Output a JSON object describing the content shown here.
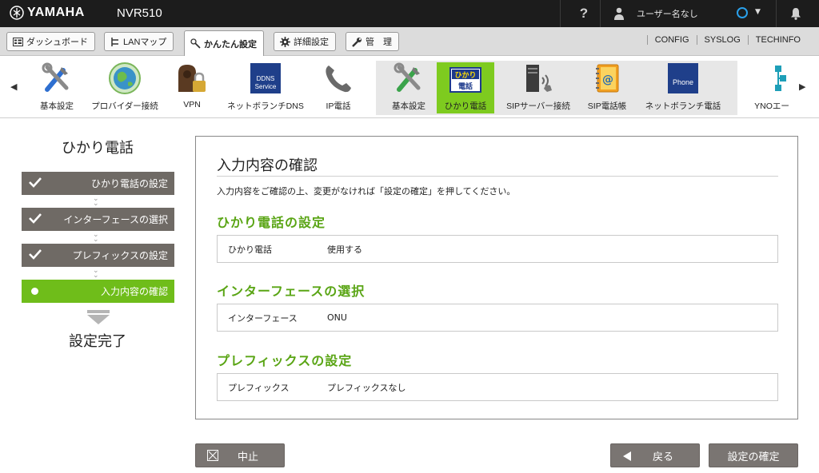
{
  "header": {
    "logo_text": "YAMAHA",
    "model": "NVR510",
    "help_label": "?",
    "user_name": "ユーザー名なし"
  },
  "tabs": [
    {
      "label": "ダッシュボード",
      "icon": "dashboard-icon"
    },
    {
      "label": "LANマップ",
      "icon": "lan-map-icon"
    },
    {
      "label": "かんたん設定",
      "icon": "wand-icon",
      "active": true
    },
    {
      "label": "詳細設定",
      "icon": "gear-icon"
    },
    {
      "label": "管　理",
      "icon": "wrench-icon"
    }
  ],
  "top_links": [
    "CONFIG",
    "SYSLOG",
    "TECHINFO"
  ],
  "icon_strip": {
    "items": [
      {
        "label": "基本設定",
        "icon": "tools-icon"
      },
      {
        "label": "プロバイダー接続",
        "icon": "globe-icon"
      },
      {
        "label": "VPN",
        "icon": "vpn-lock-icon"
      },
      {
        "label": "ネットボランチDNS",
        "icon": "ddns-service-icon",
        "icon_text": [
          "DDNS",
          "Service"
        ]
      },
      {
        "label": "IP電話",
        "icon": "phone-icon"
      },
      {
        "label": "基本設定",
        "icon": "tools-icon"
      },
      {
        "label": "ひかり電話",
        "icon": "hikari-phone-icon",
        "icon_text": [
          "ひかり",
          "電話"
        ],
        "selected": true
      },
      {
        "label": "SIPサーバー接続",
        "icon": "sip-server-icon"
      },
      {
        "label": "SIP電話帳",
        "icon": "phonebook-icon"
      },
      {
        "label": "ネットボランチ電話",
        "icon": "netvolante-phone-icon",
        "icon_text": [
          "Phone"
        ]
      },
      {
        "label": "YNOエー",
        "icon": "yno-network-icon"
      }
    ]
  },
  "wizard": {
    "title": "ひかり電話",
    "steps": [
      {
        "label": "ひかり電話の設定",
        "state": "done"
      },
      {
        "label": "インターフェースの選択",
        "state": "done"
      },
      {
        "label": "プレフィックスの設定",
        "state": "done"
      },
      {
        "label": "入力内容の確認",
        "state": "current"
      }
    ],
    "final_label": "設定完了"
  },
  "main": {
    "title": "入力内容の確認",
    "description": "入力内容をご確認の上、変更がなければ「設定の確定」を押してください。",
    "sections": [
      {
        "title": "ひかり電話の設定",
        "key": "ひかり電話",
        "value": "使用する"
      },
      {
        "title": "インターフェースの選択",
        "key": "インターフェース",
        "value": "ONU"
      },
      {
        "title": "プレフィックスの設定",
        "key": "プレフィックス",
        "value": "プレフィックスなし"
      }
    ]
  },
  "buttons": {
    "cancel": "中止",
    "back": "戻る",
    "confirm": "設定の確定"
  },
  "colors": {
    "accent_green": "#6fbd1a",
    "section_green": "#5aa515",
    "step_gray": "#6f6a65",
    "topbar": "#1c1c1c",
    "status_ring": "#2aa0ea"
  }
}
